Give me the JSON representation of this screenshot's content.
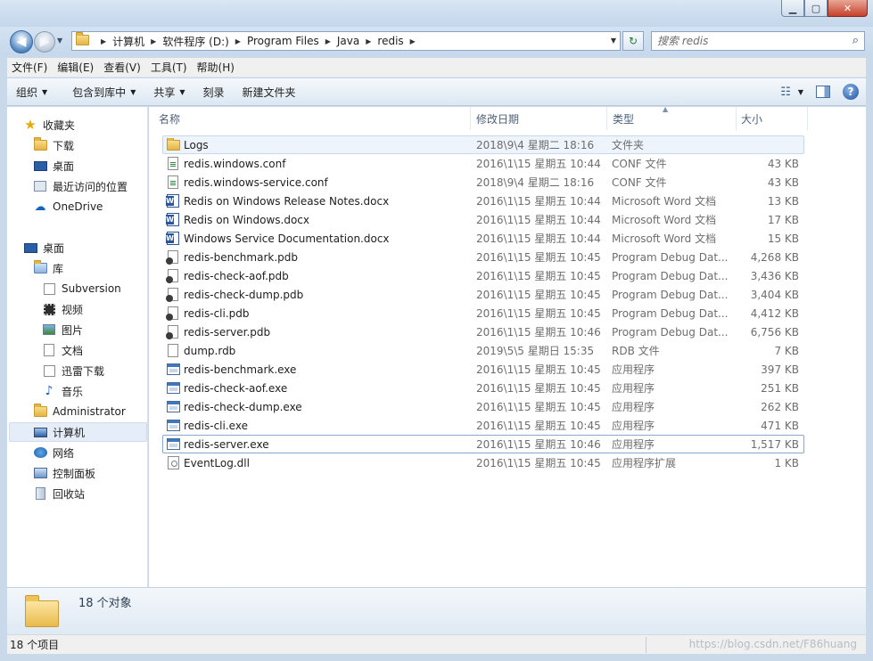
{
  "window": {
    "controls": {
      "minimize": "▁",
      "maximize": "▢",
      "close": "✕"
    }
  },
  "address": {
    "crumbs": [
      "计算机",
      "软件程序 (D:)",
      "Program Files",
      "Java",
      "redis"
    ],
    "refresh_icon": "↻"
  },
  "search": {
    "placeholder": "搜索 redis",
    "icon": "⌕"
  },
  "menu": [
    "文件(F)",
    "编辑(E)",
    "查看(V)",
    "工具(T)",
    "帮助(H)"
  ],
  "commands": {
    "organize": "组织",
    "include_in_library": "包含到库中",
    "share": "共享",
    "burn": "刻录",
    "new_folder": "新建文件夹"
  },
  "nav": {
    "favorites": {
      "label": "收藏夹",
      "items": [
        "下载",
        "桌面",
        "最近访问的位置",
        "OneDrive"
      ]
    },
    "desktop": "桌面",
    "libraries": {
      "label": "库",
      "items": [
        "Subversion",
        "视频",
        "图片",
        "文档",
        "迅雷下载",
        "音乐"
      ]
    },
    "administrator": "Administrator",
    "computer": "计算机",
    "network": "网络",
    "control_panel": "控制面板",
    "recycle_bin": "回收站"
  },
  "columns": {
    "name": "名称",
    "date": "修改日期",
    "type": "类型",
    "size": "大小"
  },
  "files": [
    {
      "name": "Logs",
      "date": "2018\\9\\4 星期二 18:16",
      "type": "文件夹",
      "size": "",
      "icon": "folder"
    },
    {
      "name": "redis.windows.conf",
      "date": "2016\\1\\15 星期五 10:44",
      "type": "CONF 文件",
      "size": "43 KB",
      "icon": "conf"
    },
    {
      "name": "redis.windows-service.conf",
      "date": "2018\\9\\4 星期二 18:16",
      "type": "CONF 文件",
      "size": "43 KB",
      "icon": "conf"
    },
    {
      "name": "Redis on Windows Release Notes.docx",
      "date": "2016\\1\\15 星期五 10:44",
      "type": "Microsoft Word 文档",
      "size": "13 KB",
      "icon": "word"
    },
    {
      "name": "Redis on Windows.docx",
      "date": "2016\\1\\15 星期五 10:44",
      "type": "Microsoft Word 文档",
      "size": "17 KB",
      "icon": "word"
    },
    {
      "name": "Windows Service Documentation.docx",
      "date": "2016\\1\\15 星期五 10:44",
      "type": "Microsoft Word 文档",
      "size": "15 KB",
      "icon": "word"
    },
    {
      "name": "redis-benchmark.pdb",
      "date": "2016\\1\\15 星期五 10:45",
      "type": "Program Debug Dat...",
      "size": "4,268 KB",
      "icon": "pdb"
    },
    {
      "name": "redis-check-aof.pdb",
      "date": "2016\\1\\15 星期五 10:45",
      "type": "Program Debug Dat...",
      "size": "3,436 KB",
      "icon": "pdb"
    },
    {
      "name": "redis-check-dump.pdb",
      "date": "2016\\1\\15 星期五 10:45",
      "type": "Program Debug Dat...",
      "size": "3,404 KB",
      "icon": "pdb"
    },
    {
      "name": "redis-cli.pdb",
      "date": "2016\\1\\15 星期五 10:45",
      "type": "Program Debug Dat...",
      "size": "4,412 KB",
      "icon": "pdb"
    },
    {
      "name": "redis-server.pdb",
      "date": "2016\\1\\15 星期五 10:46",
      "type": "Program Debug Dat...",
      "size": "6,756 KB",
      "icon": "pdb"
    },
    {
      "name": "dump.rdb",
      "date": "2019\\5\\5 星期日 15:35",
      "type": "RDB 文件",
      "size": "7 KB",
      "icon": "doc"
    },
    {
      "name": "redis-benchmark.exe",
      "date": "2016\\1\\15 星期五 10:45",
      "type": "应用程序",
      "size": "397 KB",
      "icon": "exe"
    },
    {
      "name": "redis-check-aof.exe",
      "date": "2016\\1\\15 星期五 10:45",
      "type": "应用程序",
      "size": "251 KB",
      "icon": "exe"
    },
    {
      "name": "redis-check-dump.exe",
      "date": "2016\\1\\15 星期五 10:45",
      "type": "应用程序",
      "size": "262 KB",
      "icon": "exe"
    },
    {
      "name": "redis-cli.exe",
      "date": "2016\\1\\15 星期五 10:45",
      "type": "应用程序",
      "size": "471 KB",
      "icon": "exe"
    },
    {
      "name": "redis-server.exe",
      "date": "2016\\1\\15 星期五 10:46",
      "type": "应用程序",
      "size": "1,517 KB",
      "icon": "exe"
    },
    {
      "name": "EventLog.dll",
      "date": "2016\\1\\15 星期五 10:45",
      "type": "应用程序扩展",
      "size": "1 KB",
      "icon": "dll"
    }
  ],
  "details": {
    "count": "18 个对象"
  },
  "status": {
    "count": "18 个项目",
    "watermark": "https://blog.csdn.net/F86huang"
  }
}
